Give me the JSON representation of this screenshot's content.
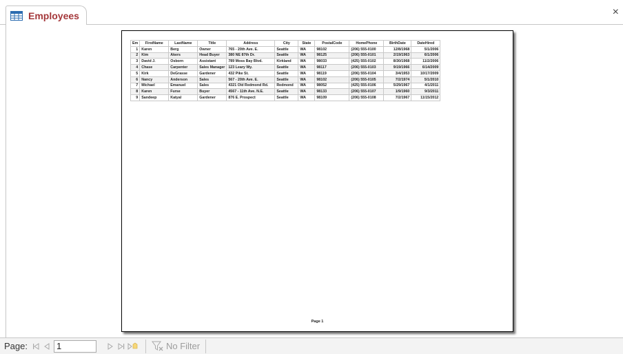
{
  "window": {
    "tab_title": "Employees",
    "close_symbol": "×"
  },
  "report": {
    "columns": [
      "Em",
      "FirstName",
      "LastName",
      "Title",
      "Address",
      "City",
      "State",
      "PostalCode",
      "HomePhone",
      "BirthDate",
      "DateHired"
    ],
    "rows": [
      [
        "1",
        "Karen",
        "Berg",
        "Owner",
        "765 - 20th Ave. E.",
        "Seattle",
        "WA",
        "98102",
        "(206) 555-0100",
        "12/8/1968",
        "5/1/2006"
      ],
      [
        "2",
        "Kim",
        "Akers",
        "Head Buyer",
        "380 NE 87th Dr.",
        "Seattle",
        "WA",
        "98125",
        "(206) 555-0101",
        "2/19/1963",
        "6/1/2006"
      ],
      [
        "3",
        "David J.",
        "Osborn",
        "Assistant",
        "789 Moss Bay Blvd.",
        "Kirkland",
        "WA",
        "98033",
        "(425) 555-0102",
        "8/30/1968",
        "11/2/2006"
      ],
      [
        "4",
        "Chase",
        "Carpenter",
        "Sales Manager",
        "123 Leary Wy.",
        "Seattle",
        "WA",
        "98117",
        "(206) 555-0103",
        "9/19/1966",
        "6/14/2009"
      ],
      [
        "5",
        "Kirk",
        "DeGrasse",
        "Gardener",
        "432 Pike St.",
        "Seattle",
        "WA",
        "98119",
        "(206) 555-0104",
        "3/4/1953",
        "10/17/2009"
      ],
      [
        "6",
        "Nancy",
        "Anderson",
        "Sales",
        "567 - 20th Ave. E.",
        "Seattle",
        "WA",
        "98102",
        "(206) 555-0105",
        "7/2/1974",
        "5/1/2010"
      ],
      [
        "7",
        "Michael",
        "Emanuel",
        "Sales",
        "4321 Old Redmond Rd.",
        "Redmond",
        "WA",
        "98052",
        "(425) 555-0106",
        "5/29/1967",
        "4/1/2011"
      ],
      [
        "8",
        "Karen",
        "Furse",
        "Buyer",
        "4567 - 11th Ave. N.E.",
        "Seattle",
        "WA",
        "98133",
        "(206) 555-0107",
        "1/9/1960",
        "9/3/2011"
      ],
      [
        "9",
        "Sandeep",
        "Katyal",
        "Gardener",
        "876 E. Prospect",
        "Seattle",
        "WA",
        "98109",
        "(206) 555-0108",
        "7/2/1967",
        "11/15/2012"
      ]
    ],
    "footer": "Page 1"
  },
  "statusbar": {
    "page_label": "Page:",
    "page_value": "1",
    "first_icon": "first-record-icon",
    "prev_icon": "previous-record-icon",
    "next_icon": "next-record-icon",
    "last_icon": "last-record-icon",
    "new_icon": "new-record-icon",
    "filter_label": "No Filter"
  }
}
